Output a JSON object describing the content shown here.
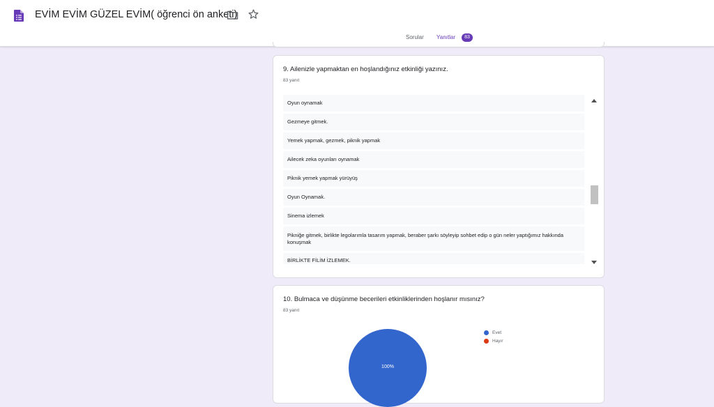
{
  "header": {
    "title": "EVİM EVİM GÜZEL EVİM( öğrenci ön anketi)",
    "icons": [
      "forms-icon",
      "folder-icon",
      "star-icon"
    ]
  },
  "tabs": {
    "questions": "Sorular",
    "responses": "Yanıtlar",
    "response_count": "83",
    "active": "Yanıtlar"
  },
  "question9": {
    "title": "9. Ailenizle yapmaktan en hoşlandığınız etkinliği yazınız.",
    "count": "83 yanıt",
    "answers": [
      "Oyun oynamak",
      "Gezmeye gitmek.",
      "Yemek yapmak, gezmek, piknik yapmak",
      "Ailecek zeka oyunları oynamak",
      "Piknik yemek yapmak yürüyüş",
      "Oyun Oynamak.",
      "Sinema izlemek",
      "Pikniğe gitmek, birlikte legolarımla tasarım yapmak, beraber şarkı söyleyip sohbet edip o gün neler yaptığımız hakkında konuşmak",
      "BİRLİKTE FİLİM İZLEMEK."
    ]
  },
  "question10": {
    "title": "10. Bulmaca ve düşünme becerileri etkinliklerinden hoşlanır mısınız?",
    "count": "83 yanıt",
    "pie_label": "100%",
    "legend": [
      {
        "label": "Evet",
        "color": "#3366cc"
      },
      {
        "label": "Hayır",
        "color": "#dc3912"
      }
    ]
  },
  "chart_data": {
    "type": "pie",
    "categories": [
      "Evet",
      "Hayır"
    ],
    "values": [
      100,
      0
    ],
    "legend_position": "right"
  },
  "colors": {
    "accent": "#673ab7",
    "background": "#f0ebf8"
  }
}
